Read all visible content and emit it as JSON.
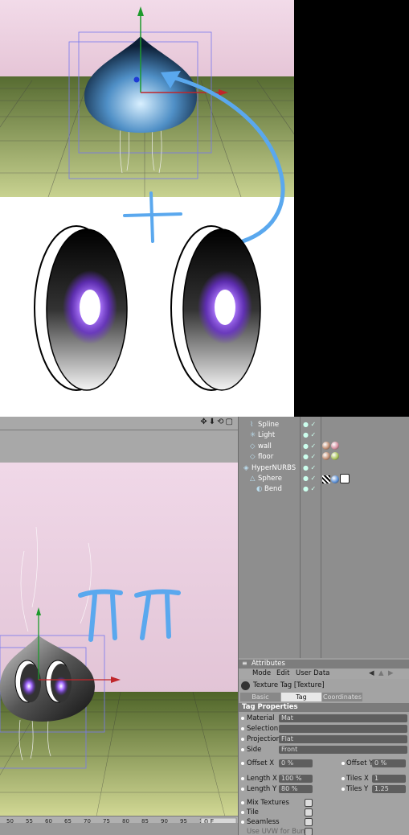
{
  "object_manager": {
    "objects": [
      {
        "name": "Spline",
        "indent": 1,
        "icon": "spline-icon"
      },
      {
        "name": "Light",
        "indent": 1,
        "icon": "light-icon"
      },
      {
        "name": "wall",
        "indent": 1,
        "icon": "floor-icon",
        "tags": [
          "#c39075",
          "#d68fa0"
        ]
      },
      {
        "name": "floor",
        "indent": 1,
        "icon": "floor-icon",
        "tags": [
          "#c39075",
          "#a9c45a"
        ]
      },
      {
        "name": "HyperNURBS",
        "indent": 0,
        "icon": "hypernurbs-icon"
      },
      {
        "name": "Sphere",
        "indent": 1,
        "icon": "sphere-icon",
        "tags": [
          "checker",
          "#5a8fd6",
          "phong"
        ]
      },
      {
        "name": "Bend",
        "indent": 2,
        "icon": "bend-icon"
      }
    ]
  },
  "attributes": {
    "header": "Attributes",
    "menu": [
      "Mode",
      "Edit",
      "User Data"
    ],
    "title": "Texture Tag [Texture]",
    "tabs": [
      {
        "label": "Basic",
        "active": false
      },
      {
        "label": "Tag",
        "active": true
      },
      {
        "label": "Coordinates",
        "active": false
      }
    ],
    "section": "Tag Properties",
    "material": {
      "label": "Material",
      "value": "Mat"
    },
    "selection": {
      "label": "Selection",
      "value": ""
    },
    "projection": {
      "label": "Projection",
      "value": "Flat"
    },
    "side": {
      "label": "Side",
      "value": "Front"
    },
    "offset_x": {
      "label": "Offset X",
      "value": "0 %"
    },
    "offset_y": {
      "label": "Offset Y",
      "value": "0 %"
    },
    "length_x": {
      "label": "Length X",
      "value": "100 %"
    },
    "tiles_x": {
      "label": "Tiles X",
      "value": "1"
    },
    "length_y": {
      "label": "Length Y",
      "value": "80 %"
    },
    "tiles_y": {
      "label": "Tiles Y",
      "value": "1.25"
    },
    "mix_textures": {
      "label": "Mix Textures",
      "checked": false
    },
    "tile": {
      "label": "Tile",
      "checked": false
    },
    "seamless": {
      "label": "Seamless",
      "checked": false
    },
    "use_uvw": {
      "label": "Use UVW for Bump",
      "checked": false
    }
  },
  "timeline": {
    "ticks": [
      "50",
      "55",
      "60",
      "65",
      "70",
      "75",
      "80",
      "85",
      "90",
      "95",
      "100"
    ],
    "frame": "0 F"
  },
  "annotations": {
    "plus": "+",
    "pi": "ππ"
  },
  "colors": {
    "annotation_blue": "#5aa8ee",
    "viewport_pink": "#e8cfe0",
    "floor_green": "#7f9a48",
    "eye_glow": "#8a3cff"
  }
}
